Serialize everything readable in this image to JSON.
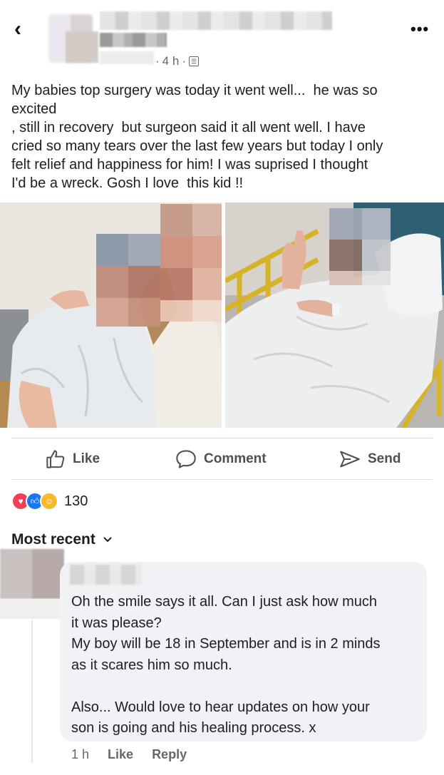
{
  "header": {
    "back_icon": "chevron-left-icon",
    "time": "4 h",
    "audience_icon": "friends-icon",
    "more_icon": "more-dots-icon"
  },
  "post": {
    "lines": [
      "My babies top surgery was today it went well...  he was so",
      "excited",
      ", still in recovery  but surgeon said it all went well. I have",
      "cried so many tears over the last few years but today I only",
      "felt relief and happiness for him! I was suprised I thought",
      "I'd be a wreck. Gosh I love  this kid !!"
    ]
  },
  "actions": {
    "like": "Like",
    "comment": "Comment",
    "send": "Send"
  },
  "reactions": {
    "count": "130",
    "types": [
      "love",
      "like",
      "care"
    ],
    "colors": {
      "love": "#f33e58",
      "like": "#1877f2",
      "care": "#f7b928"
    }
  },
  "comments_sort": "Most recent",
  "comment": {
    "lines": [
      "Oh the smile says it all. Can I just ask how much",
      "it was please?",
      "My boy will be 18 in September and is in 2 minds",
      "as it scares him so much.",
      "",
      "Also... Would love to hear updates on how your",
      "son is going and his healing process. x"
    ],
    "time": "1 h",
    "like": "Like",
    "reply": "Reply"
  }
}
